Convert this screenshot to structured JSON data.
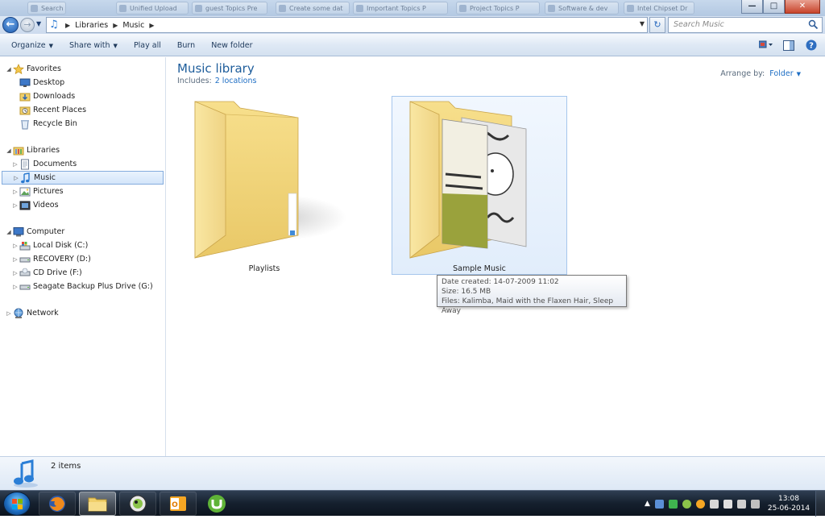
{
  "window": {
    "background_tabs": [
      "Search results",
      "Unified Upload",
      "guest Topics Pre",
      "Create some dat",
      "Important Topics P",
      "Project Topics P",
      "Software & dev",
      "Intel Chipset Dr"
    ],
    "controls": {
      "minimize": "—",
      "maximize": "□",
      "close": "✕"
    }
  },
  "address_bar": {
    "breadcrumbs": [
      "Libraries",
      "Music"
    ],
    "search_placeholder": "Search Music"
  },
  "toolbar": {
    "organize": "Organize",
    "share_with": "Share with",
    "play_all": "Play all",
    "burn": "Burn",
    "new_folder": "New folder"
  },
  "nav": {
    "favorites": {
      "label": "Favorites",
      "items": [
        "Desktop",
        "Downloads",
        "Recent Places",
        "Recycle Bin"
      ]
    },
    "libraries": {
      "label": "Libraries",
      "items": [
        "Documents",
        "Music",
        "Pictures",
        "Videos"
      ],
      "selected": "Music"
    },
    "computer": {
      "label": "Computer",
      "items": [
        "Local Disk (C:)",
        "RECOVERY (D:)",
        "CD Drive (F:)",
        "Seagate Backup Plus Drive (G:)"
      ]
    },
    "network": {
      "label": "Network"
    }
  },
  "library": {
    "title": "Music library",
    "includes_label": "Includes:",
    "includes_link": "2 locations",
    "arrange_label": "Arrange by:",
    "arrange_value": "Folder"
  },
  "items": [
    {
      "name": "Playlists"
    },
    {
      "name": "Sample Music"
    }
  ],
  "tooltip": {
    "date_created": "Date created: 14-07-2009 11:02",
    "size": "Size: 16.5 MB",
    "files": "Files: Kalimba, Maid with the Flaxen Hair, Sleep Away"
  },
  "details": {
    "count": "2 items"
  },
  "taskbar": {
    "time": "13:08",
    "date": "25-06-2014"
  },
  "colors": {
    "accent": "#1e6ec4",
    "title_green": "#1e5d9b",
    "folder_yellow": "#f5d77a",
    "selection_border": "#84acdd"
  }
}
